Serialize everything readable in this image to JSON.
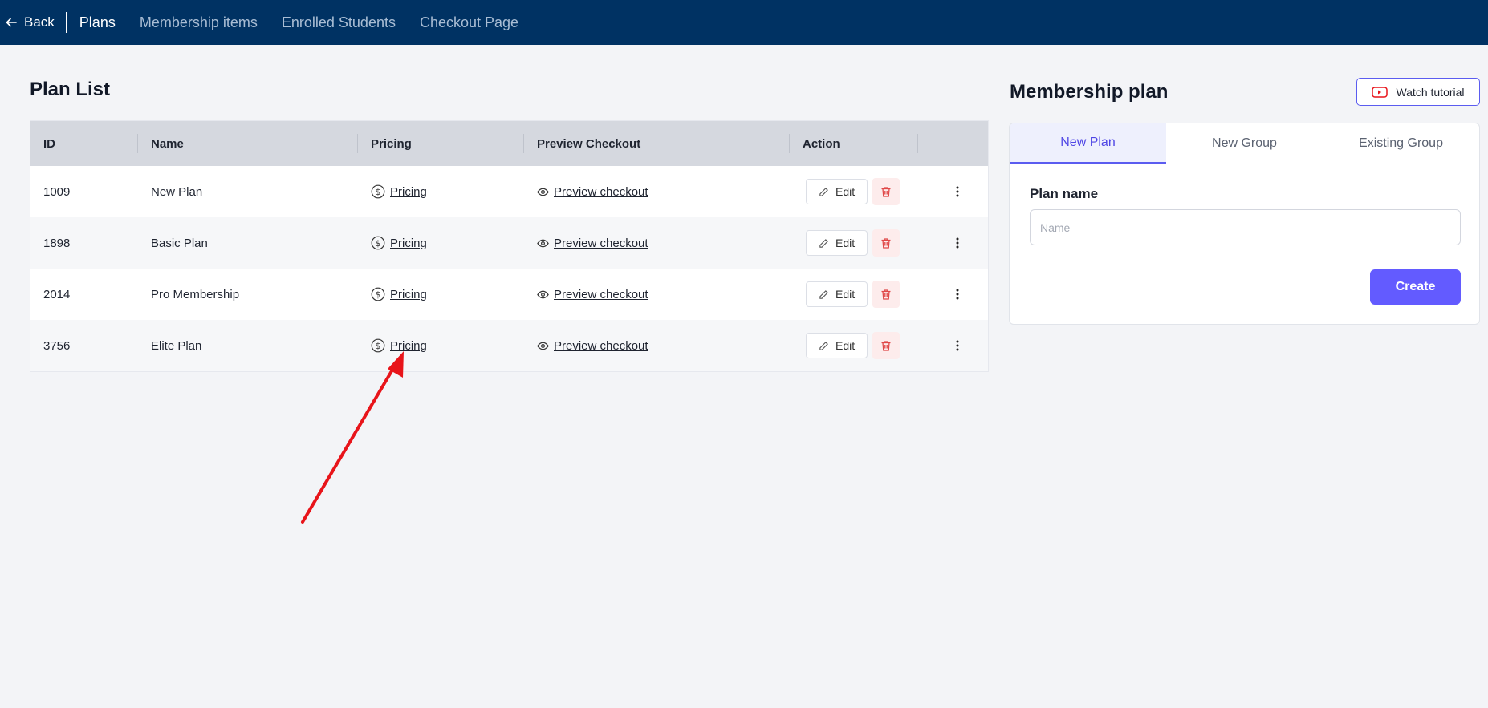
{
  "nav": {
    "back_label": "Back",
    "tabs": [
      {
        "label": "Plans",
        "active": true
      },
      {
        "label": "Membership items",
        "active": false
      },
      {
        "label": "Enrolled Students",
        "active": false
      },
      {
        "label": "Checkout Page",
        "active": false
      }
    ]
  },
  "plan_list": {
    "title": "Plan List",
    "columns": [
      "ID",
      "Name",
      "Pricing",
      "Preview Checkout",
      "Action",
      ""
    ],
    "rows": [
      {
        "id": "1009",
        "name": "New Plan",
        "pricing": "Pricing",
        "preview": "Preview checkout",
        "edit": "Edit"
      },
      {
        "id": "1898",
        "name": "Basic Plan",
        "pricing": "Pricing",
        "preview": "Preview checkout",
        "edit": "Edit"
      },
      {
        "id": "2014",
        "name": "Pro Membership",
        "pricing": "Pricing",
        "preview": "Preview checkout",
        "edit": "Edit"
      },
      {
        "id": "3756",
        "name": "Elite Plan",
        "pricing": "Pricing",
        "preview": "Preview checkout",
        "edit": "Edit"
      }
    ]
  },
  "membership_plan": {
    "title": "Membership plan",
    "watch_label": "Watch tutorial",
    "tabs": [
      {
        "label": "New Plan",
        "active": true
      },
      {
        "label": "New Group",
        "active": false
      },
      {
        "label": "Existing Group",
        "active": false
      }
    ],
    "field_label": "Plan name",
    "field_placeholder": "Name",
    "field_value": "",
    "create_label": "Create"
  },
  "colors": {
    "nav_bg": "#003263",
    "accent": "#635bff",
    "annotation_arrow": "#e8141a",
    "delete_red": "#e04848"
  },
  "icons": [
    "back-arrow-icon",
    "dollar-circle-icon",
    "eye-icon",
    "edit-pencil-icon",
    "trash-icon",
    "more-vertical-icon",
    "youtube-icon"
  ]
}
